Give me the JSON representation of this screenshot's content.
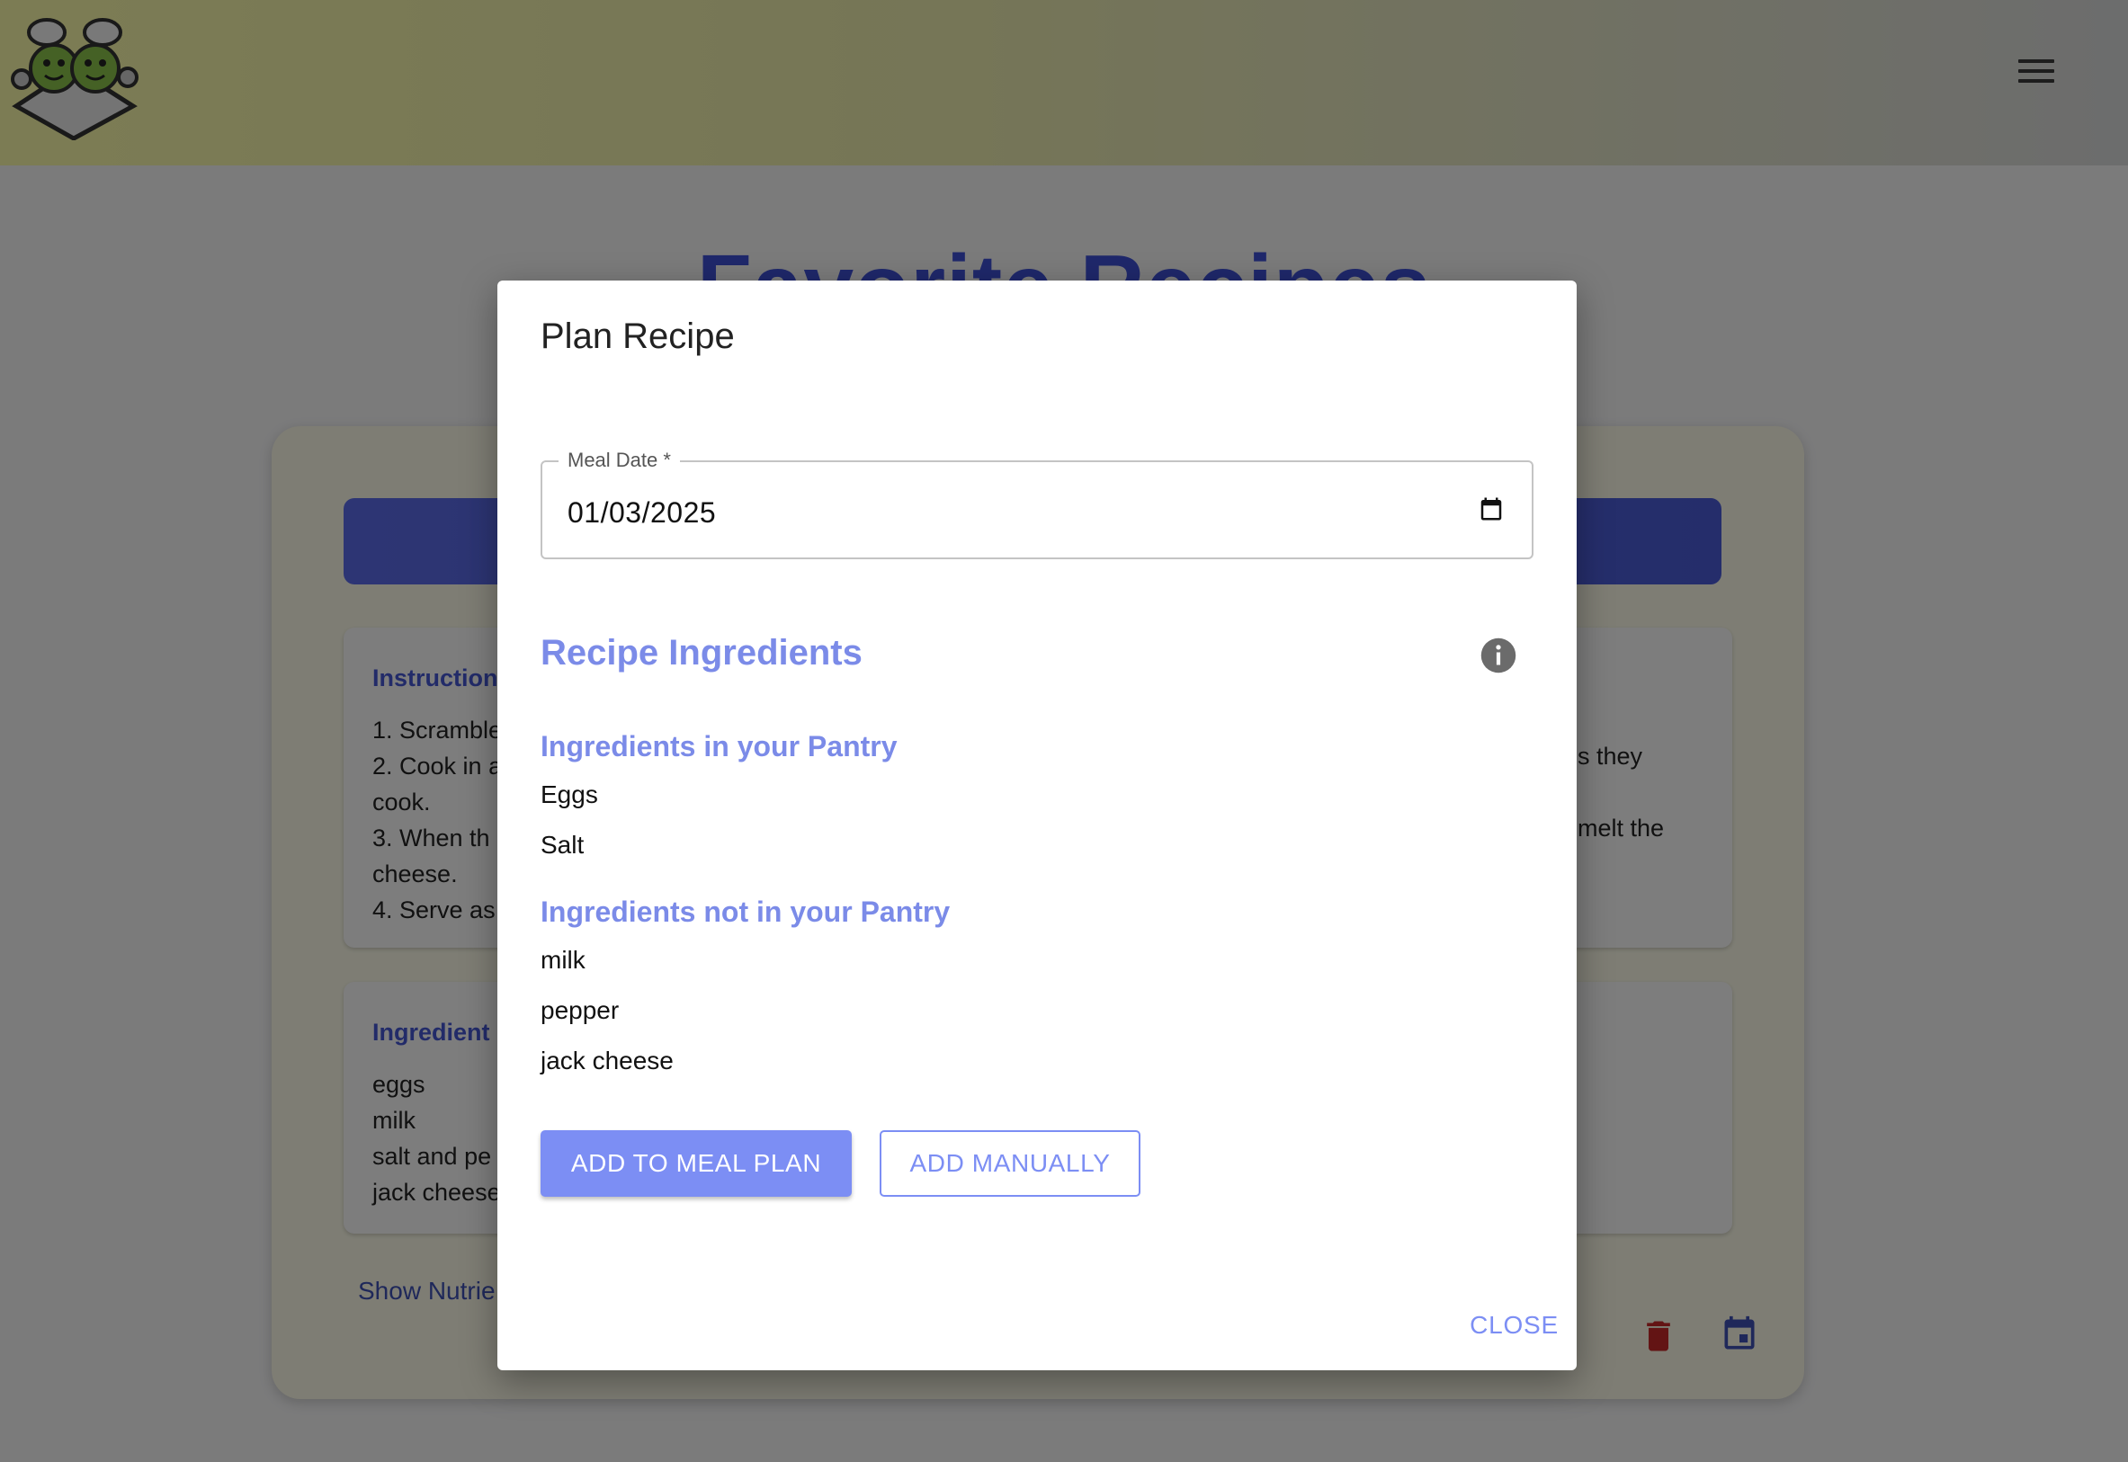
{
  "header": {
    "logo_icon": "frog-chefs-logo",
    "menu_icon": "hamburger-menu-icon"
  },
  "page": {
    "title": "Favorite Recipes"
  },
  "background_card": {
    "instructions_heading": "Instruction",
    "instruction_lines": [
      "1. Scramble",
      "2. Cook in a",
      "cook.",
      "3. When th",
      "cheese.",
      "4. Serve as"
    ],
    "instruction_right_fragments": [
      "s they",
      "melt the"
    ],
    "ingredients_heading": "Ingredient",
    "ingredient_lines": [
      "eggs",
      "milk",
      "salt and pe",
      "jack cheese"
    ],
    "show_link": "Show Nutrie",
    "delete_icon": "trash-icon",
    "plan_icon": "calendar-icon",
    "delete_color": "#c62828",
    "plan_color": "#3f51b5"
  },
  "dialog": {
    "title": "Plan Recipe",
    "meal_date": {
      "label": "Meal Date *",
      "value": "01/03/2025"
    },
    "section_title": "Recipe Ingredients",
    "in_pantry_heading": "Ingredients in your Pantry",
    "in_pantry": [
      "Eggs",
      "Salt"
    ],
    "not_in_pantry_heading": "Ingredients not in your Pantry",
    "not_in_pantry": [
      "milk",
      "pepper",
      "jack cheese"
    ],
    "add_button": "ADD TO MEAL PLAN",
    "manual_button": "ADD MANUALLY",
    "close_button": "CLOSE",
    "accent_color": "#7c8ef4"
  }
}
